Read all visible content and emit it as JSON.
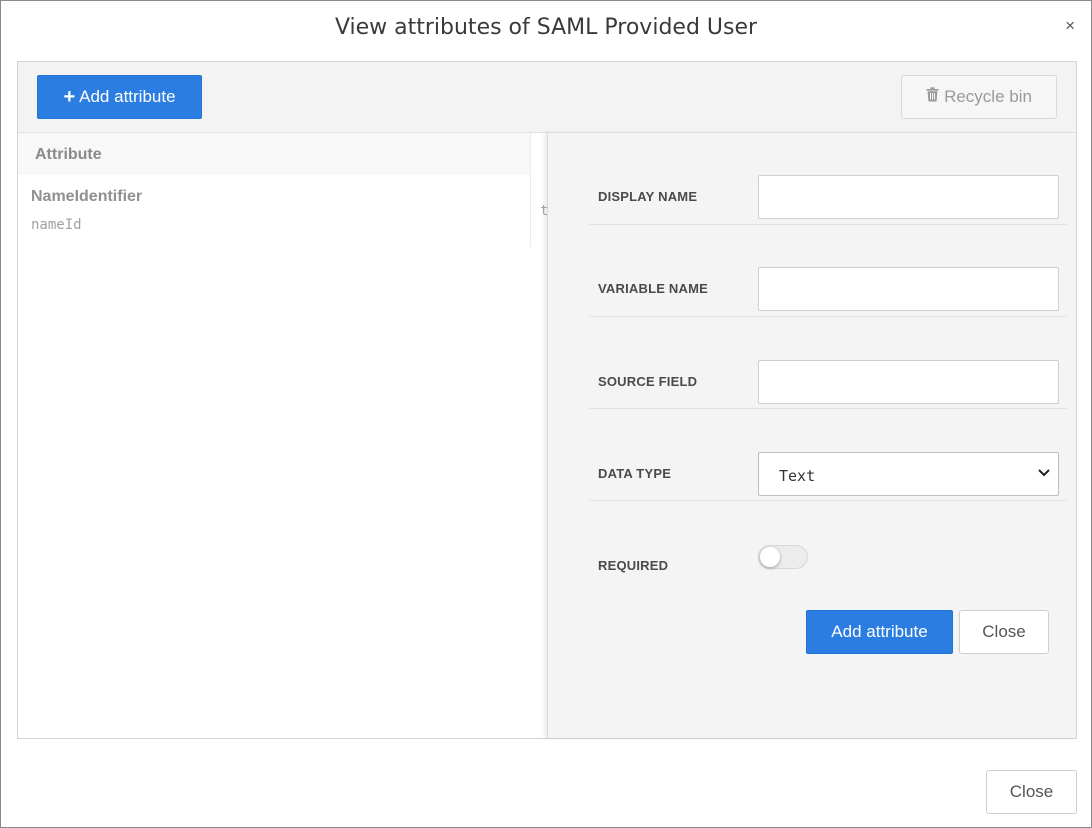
{
  "dialog": {
    "title": "View attributes of SAML Provided User",
    "close_glyph": "×",
    "footer_close_label": "Close"
  },
  "toolbar": {
    "add_label": "Add attribute",
    "add_icon": "plus-icon",
    "recycle_label": "Recycle bin",
    "recycle_icon": "trash-icon",
    "recycle_disabled": true
  },
  "list": {
    "header": "Attribute",
    "rows": [
      {
        "display_name": "NameIdentifier",
        "variable_name": "nameId",
        "peek": "t"
      }
    ]
  },
  "form": {
    "display_name": {
      "label": "DISPLAY NAME",
      "value": ""
    },
    "variable_name": {
      "label": "VARIABLE NAME",
      "value": ""
    },
    "source_field": {
      "label": "SOURCE FIELD",
      "value": ""
    },
    "data_type": {
      "label": "DATA TYPE",
      "selected": "Text"
    },
    "required": {
      "label": "REQUIRED",
      "on": false
    },
    "submit_label": "Add attribute",
    "close_label": "Close"
  },
  "colors": {
    "primary": "#2b7de1",
    "form_background": "#f4f4f4",
    "toolbar_background": "#f3f3f3"
  }
}
